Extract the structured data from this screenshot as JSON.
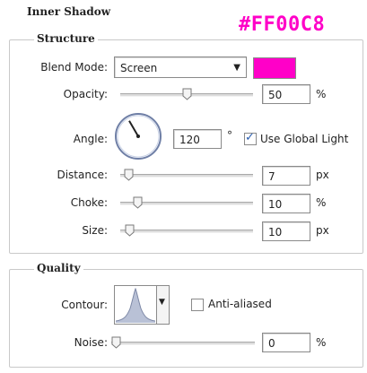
{
  "panel": {
    "title": "Inner Shadow",
    "annotation_hex": "#FF00C8"
  },
  "structure": {
    "title": "Structure",
    "blend_mode": {
      "label": "Blend Mode:",
      "value": "Screen"
    },
    "swatch_color": "#ff00c8",
    "opacity": {
      "label": "Opacity:",
      "value": "50",
      "unit": "%",
      "level": 0.5
    },
    "angle": {
      "label": "Angle:",
      "value": "120",
      "unit": "°",
      "degrees": 120
    },
    "use_global_light": {
      "label": "Use Global Light",
      "checked": true
    },
    "distance": {
      "label": "Distance:",
      "value": "7",
      "unit": "px",
      "level": 0.03
    },
    "choke": {
      "label": "Choke:",
      "value": "10",
      "unit": "%",
      "level": 0.1
    },
    "size": {
      "label": "Size:",
      "value": "10",
      "unit": "px",
      "level": 0.04
    }
  },
  "quality": {
    "title": "Quality",
    "contour": {
      "label": "Contour:"
    },
    "anti_aliased": {
      "label": "Anti-aliased",
      "checked": false
    },
    "noise": {
      "label": "Noise:",
      "value": "0",
      "unit": "%",
      "level": 0.0
    }
  },
  "icons": {
    "dropdown": "chevron-down-icon",
    "slider_thumb": "slider-thumb-icon",
    "checkmark": "check-icon",
    "angle_dial": "angle-dial-icon",
    "contour_preview": "contour-curve-icon"
  }
}
